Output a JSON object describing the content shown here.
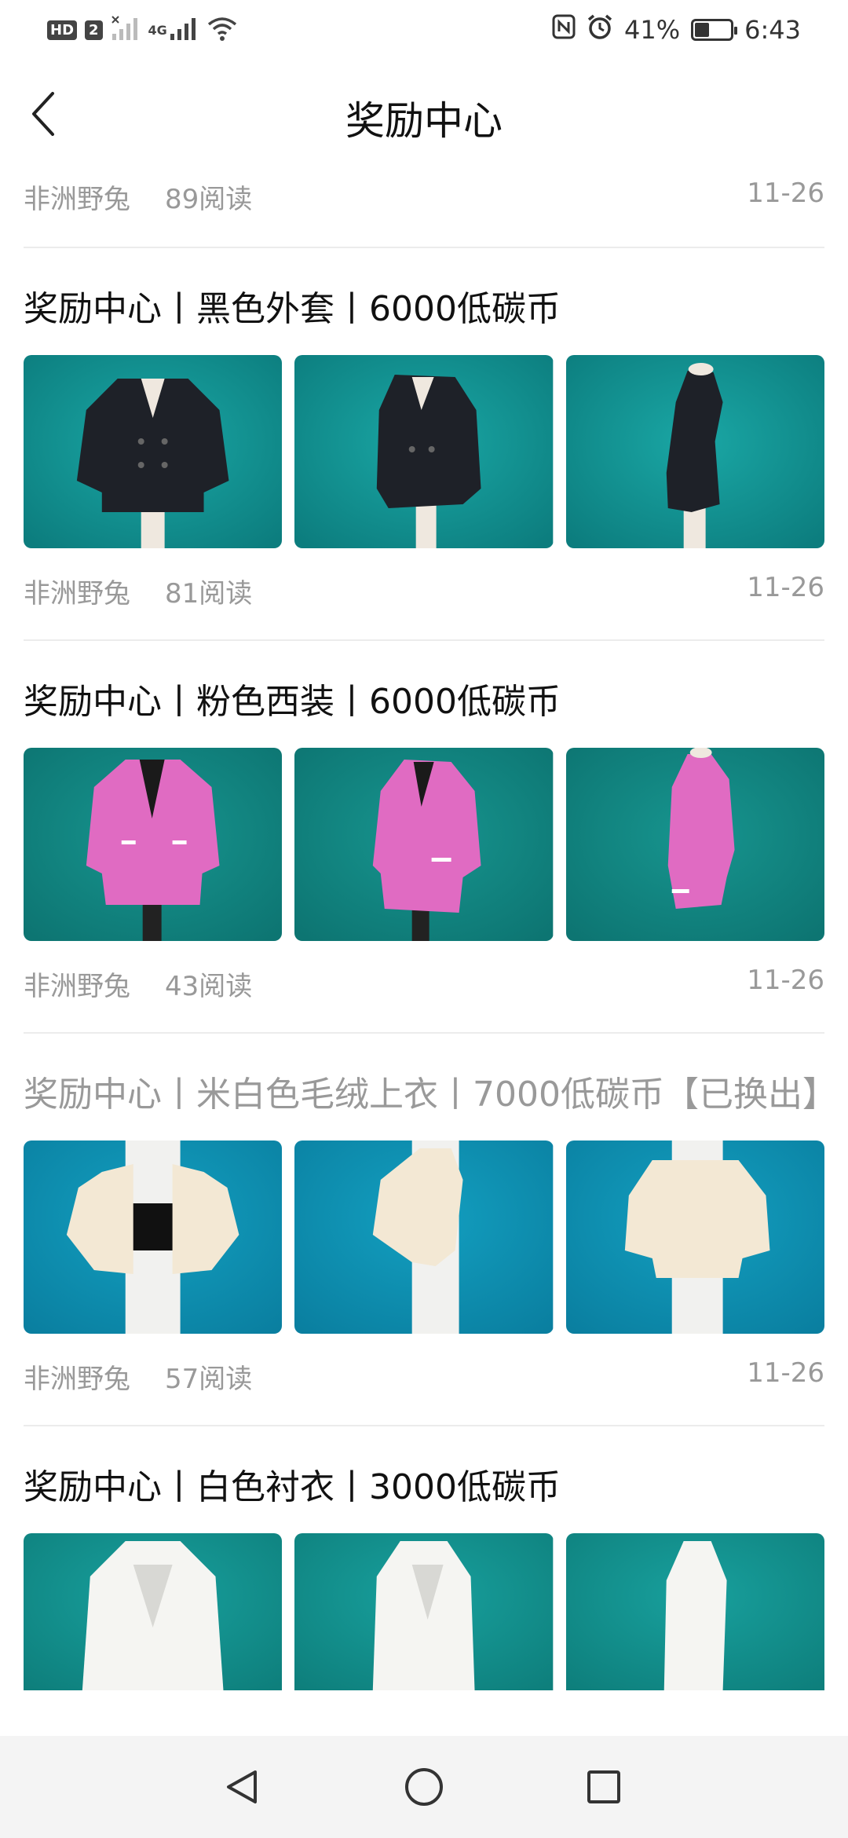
{
  "status": {
    "left_badges": [
      "HD",
      "2"
    ],
    "network": "4G",
    "battery_percent_text": "41%",
    "battery_level": 0.41,
    "time": "6:43"
  },
  "header": {
    "title": "奖励中心"
  },
  "top_meta": {
    "author": "非洲野兔",
    "reads": "89阅读",
    "date": "11-26"
  },
  "posts": [
    {
      "title": "奖励中心丨黑色外套丨6000低碳币",
      "exchanged": false,
      "author": "非洲野兔",
      "reads": "81阅读",
      "date": "11-26"
    },
    {
      "title": "奖励中心丨粉色西装丨6000低碳币",
      "exchanged": false,
      "author": "非洲野兔",
      "reads": "43阅读",
      "date": "11-26"
    },
    {
      "title": "奖励中心丨米白色毛绒上衣丨7000低碳币【已换出】",
      "exchanged": true,
      "author": "非洲野兔",
      "reads": "57阅读",
      "date": "11-26"
    },
    {
      "title": "奖励中心丨白色衬衣丨3000低碳币",
      "exchanged": false
    }
  ],
  "colors": {
    "teal_bg": "#12908f",
    "blue_bg": "#0a8fb0",
    "jacket_black": "#1e2128",
    "jacket_pink": "#e06bc2",
    "fur_cream": "#f3e8d4",
    "shirt_white": "#f5f5f2"
  }
}
